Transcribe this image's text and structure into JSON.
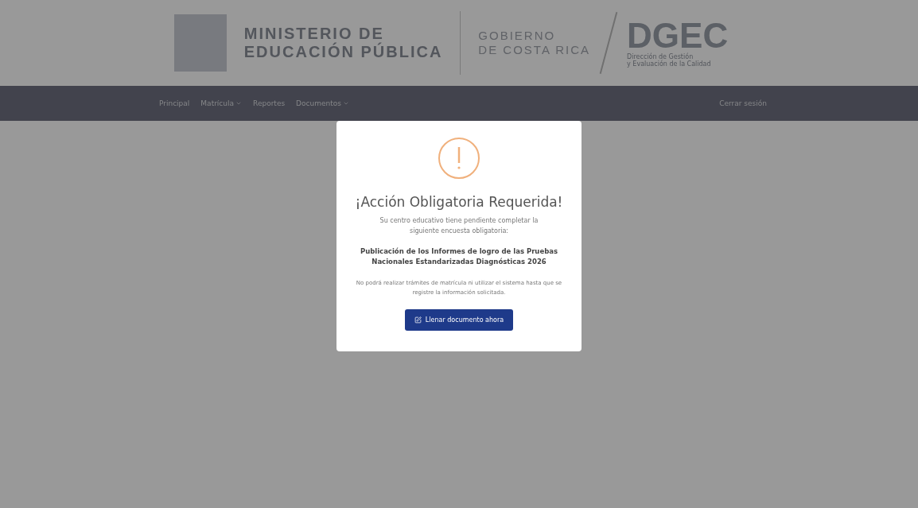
{
  "header": {
    "ministry": [
      "MINISTERIO DE",
      "EDUCACIÓN PÚBLICA"
    ],
    "government": [
      "GOBIERNO",
      "DE COSTA RICA"
    ],
    "dgec": {
      "title": "DGEC",
      "subtitle": [
        "Dirección de Gestión",
        "y Evaluación de la Calidad"
      ]
    }
  },
  "nav": {
    "items": [
      {
        "label": "Principal",
        "dropdown": false
      },
      {
        "label": "Matrícula",
        "dropdown": true
      },
      {
        "label": "Reportes",
        "dropdown": false
      },
      {
        "label": "Documentos",
        "dropdown": true
      }
    ],
    "logout": "Cerrar sesión"
  },
  "modal": {
    "title": "¡Acción Obligatoria Requerida!",
    "message": "Su centro educativo tiene pendiente completar la siguiente encuesta obligatoria:",
    "survey": "Publicación de los Informes de logro de las Pruebas Nacionales Estandarizadas Diagnósticas 2026",
    "warning": "No podrá realizar trámites de matrícula ni utilizar el sistema hasta que se registre la información solicitada.",
    "button": "Llenar documento ahora"
  }
}
